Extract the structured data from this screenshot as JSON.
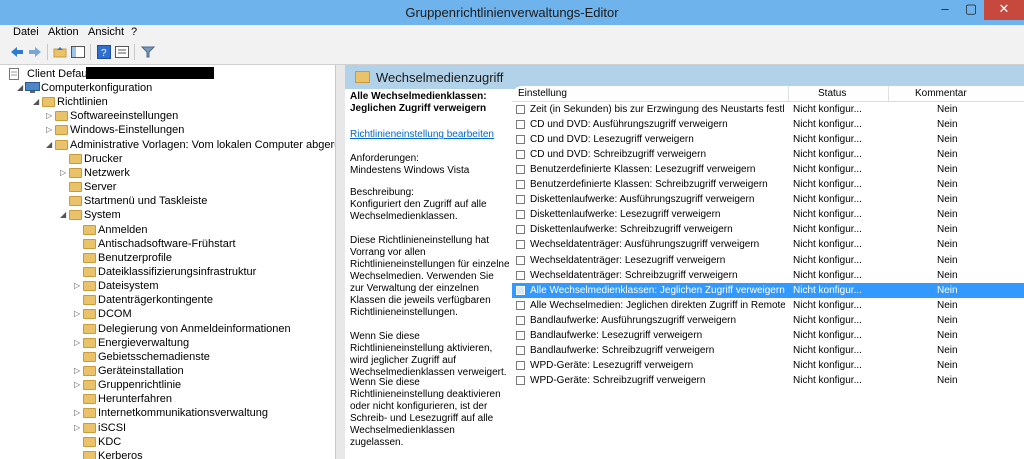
{
  "window": {
    "title": "Gruppenrichtlinienverwaltungs-Editor",
    "min": "–",
    "max": "▢",
    "close": "✕"
  },
  "menu": [
    "Datei",
    "Aktion",
    "Ansicht",
    "?"
  ],
  "toolbar": [
    "back-icon",
    "forward-icon",
    "up-folder-icon",
    "show-hide-tree-icon",
    "help-icon",
    "properties-icon",
    "filter-icon"
  ],
  "tree": {
    "root": "Client Default",
    "items": [
      {
        "label": "Computerkonfiguration",
        "level": 1,
        "arrow": "◢",
        "icon": "computer"
      },
      {
        "label": "Richtlinien",
        "level": 2,
        "arrow": "◢"
      },
      {
        "label": "Softwareeinstellungen",
        "level": 3,
        "arrow": "▷"
      },
      {
        "label": "Windows-Einstellungen",
        "level": 3,
        "arrow": "▷"
      },
      {
        "label": "Administrative Vorlagen: Vom lokalen Computer abgerufene R",
        "level": 3,
        "arrow": "◢"
      },
      {
        "label": "Drucker",
        "level": 4,
        "arrow": ""
      },
      {
        "label": "Netzwerk",
        "level": 4,
        "arrow": "▷"
      },
      {
        "label": "Server",
        "level": 4,
        "arrow": ""
      },
      {
        "label": "Startmenü und Taskleiste",
        "level": 4,
        "arrow": ""
      },
      {
        "label": "System",
        "level": 4,
        "arrow": "◢"
      },
      {
        "label": "Anmelden",
        "level": 5,
        "arrow": ""
      },
      {
        "label": "Antischadsoftware-Frühstart",
        "level": 5,
        "arrow": ""
      },
      {
        "label": "Benutzerprofile",
        "level": 5,
        "arrow": ""
      },
      {
        "label": "Dateiklassifizierungsinfrastruktur",
        "level": 5,
        "arrow": ""
      },
      {
        "label": "Dateisystem",
        "level": 5,
        "arrow": "▷"
      },
      {
        "label": "Datenträgerkontingente",
        "level": 5,
        "arrow": ""
      },
      {
        "label": "DCOM",
        "level": 5,
        "arrow": "▷"
      },
      {
        "label": "Delegierung von Anmeldeinformationen",
        "level": 5,
        "arrow": ""
      },
      {
        "label": "Energieverwaltung",
        "level": 5,
        "arrow": "▷"
      },
      {
        "label": "Gebietsschemadienste",
        "level": 5,
        "arrow": ""
      },
      {
        "label": "Geräteinstallation",
        "level": 5,
        "arrow": "▷"
      },
      {
        "label": "Gruppenrichtlinie",
        "level": 5,
        "arrow": "▷"
      },
      {
        "label": "Herunterfahren",
        "level": 5,
        "arrow": ""
      },
      {
        "label": "Internetkommunikationsverwaltung",
        "level": 5,
        "arrow": "▷"
      },
      {
        "label": "iSCSI",
        "level": 5,
        "arrow": "▷"
      },
      {
        "label": "KDC",
        "level": 5,
        "arrow": ""
      },
      {
        "label": "Kerberos",
        "level": 5,
        "arrow": ""
      }
    ]
  },
  "details": {
    "header": "Wechselmedienzugriff",
    "policy_title": "Alle Wechselmedienklassen: Jeglichen Zugriff verweigern",
    "edit_link": "Richtlinieneinstellung bearbeiten",
    "requirements_label": "Anforderungen:",
    "requirements_value": "Mindestens Windows Vista",
    "description_label": "Beschreibung:",
    "description_text": "Konfiguriert den Zugriff auf alle Wechselmedienklassen.",
    "para1": "Diese Richtlinieneinstellung hat Vorrang vor allen Richtlinieneinstellungen für einzelne Wechselmedien. Verwenden Sie zur Verwaltung der einzelnen Klassen die jeweils verfügbaren Richtlinieneinstellungen.",
    "para2": "Wenn Sie diese Richtlinieneinstellung aktivieren, wird jeglicher Zugriff auf Wechselmedienklassen verweigert.",
    "para3": "Wenn Sie diese Richtlinieneinstellung deaktivieren oder nicht konfigurieren, ist der Schreib- und Lesezugriff auf alle Wechselmedienklassen zugelassen."
  },
  "table": {
    "headers": {
      "name": "Einstellung",
      "status": "Status",
      "comment": "Kommentar"
    },
    "rows": [
      {
        "name": "Zeit (in Sekunden) bis zur Erzwingung des Neustarts festlegen",
        "status": "Nicht konfigur...",
        "comment": "Nein"
      },
      {
        "name": "CD und DVD: Ausführungszugriff verweigern",
        "status": "Nicht konfigur...",
        "comment": "Nein"
      },
      {
        "name": "CD und DVD: Lesezugriff verweigern",
        "status": "Nicht konfigur...",
        "comment": "Nein"
      },
      {
        "name": "CD und DVD: Schreibzugriff verweigern",
        "status": "Nicht konfigur...",
        "comment": "Nein"
      },
      {
        "name": "Benutzerdefinierte Klassen: Lesezugriff verweigern",
        "status": "Nicht konfigur...",
        "comment": "Nein"
      },
      {
        "name": "Benutzerdefinierte Klassen: Schreibzugriff verweigern",
        "status": "Nicht konfigur...",
        "comment": "Nein"
      },
      {
        "name": "Diskettenlaufwerke: Ausführungszugriff verweigern",
        "status": "Nicht konfigur...",
        "comment": "Nein"
      },
      {
        "name": "Diskettenlaufwerke: Lesezugriff verweigern",
        "status": "Nicht konfigur...",
        "comment": "Nein"
      },
      {
        "name": "Diskettenlaufwerke: Schreibzugriff verweigern",
        "status": "Nicht konfigur...",
        "comment": "Nein"
      },
      {
        "name": "Wechseldatenträger: Ausführungszugriff verweigern",
        "status": "Nicht konfigur...",
        "comment": "Nein"
      },
      {
        "name": "Wechseldatenträger: Lesezugriff verweigern",
        "status": "Nicht konfigur...",
        "comment": "Nein"
      },
      {
        "name": "Wechseldatenträger: Schreibzugriff verweigern",
        "status": "Nicht konfigur...",
        "comment": "Nein"
      },
      {
        "name": "Alle Wechselmedienklassen: Jeglichen Zugriff verweigern",
        "status": "Nicht konfigur...",
        "comment": "Nein",
        "selected": true
      },
      {
        "name": "Alle Wechselmedien: Jeglichen direkten Zugriff in Remotesit...",
        "status": "Nicht konfigur...",
        "comment": "Nein"
      },
      {
        "name": "Bandlaufwerke: Ausführungszugriff verweigern",
        "status": "Nicht konfigur...",
        "comment": "Nein"
      },
      {
        "name": "Bandlaufwerke: Lesezugriff verweigern",
        "status": "Nicht konfigur...",
        "comment": "Nein"
      },
      {
        "name": "Bandlaufwerke: Schreibzugriff verweigern",
        "status": "Nicht konfigur...",
        "comment": "Nein"
      },
      {
        "name": "WPD-Geräte: Lesezugriff verweigern",
        "status": "Nicht konfigur...",
        "comment": "Nein"
      },
      {
        "name": "WPD-Geräte: Schreibzugriff verweigern",
        "status": "Nicht konfigur...",
        "comment": "Nein"
      }
    ]
  }
}
